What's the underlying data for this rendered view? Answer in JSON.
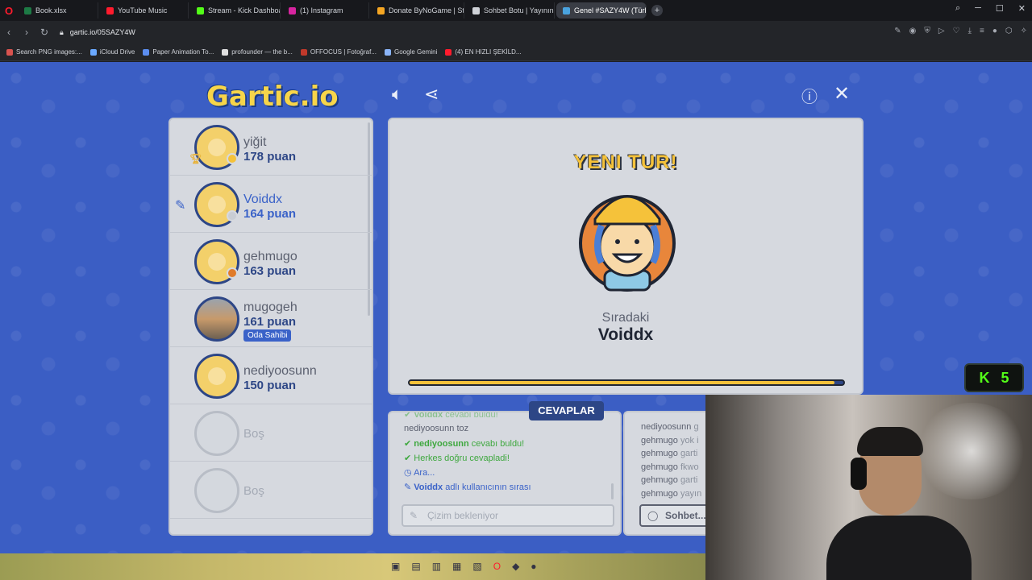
{
  "browser": {
    "tabs": [
      {
        "label": "Book.xlsx",
        "color": "#1d7a45",
        "active": false
      },
      {
        "label": "YouTube Music",
        "color": "#ff1b2d",
        "active": false
      },
      {
        "label": "Stream - Kick Dashboard",
        "color": "#53fc18",
        "active": false
      },
      {
        "label": "(1) Instagram",
        "color": "#d6249f",
        "active": false
      },
      {
        "label": "Donate ByNoGame | Strea",
        "color": "#f5a623",
        "active": false
      },
      {
        "label": "Sohbet Botu | Yayınını güç",
        "color": "#cfd2d8",
        "active": false
      },
      {
        "label": "Genel #SAZY4W (Türk",
        "color": "#4aa3df",
        "active": true
      }
    ],
    "url": "gartic.io/05SAZY4W",
    "bookmarks": [
      {
        "label": "Search PNG images:...",
        "color": "#d9534f"
      },
      {
        "label": "iCloud Drive",
        "color": "#6aa9ff"
      },
      {
        "label": "Paper Animation To...",
        "color": "#5b8def"
      },
      {
        "label": "profounder — the b...",
        "color": "#e0e0e0"
      },
      {
        "label": "OFFOCUS | Fotoğraf...",
        "color": "#c0392b"
      },
      {
        "label": "Google Gemini",
        "color": "#8ab4f8"
      },
      {
        "label": "(4) EN HIZLI ŞEKİLD...",
        "color": "#ff1b2d"
      }
    ]
  },
  "game": {
    "logo": "Gartic.io",
    "players": [
      {
        "name": "yiğit",
        "score": "178 puan",
        "dot_color": "#f5c23a",
        "active": false,
        "owner": "",
        "empty": false
      },
      {
        "name": "Voiddx",
        "score": "164 puan",
        "dot_color": "#c9cdd4",
        "active": true,
        "owner": "",
        "empty": false
      },
      {
        "name": "gehmugo",
        "score": "163 puan",
        "dot_color": "#e07b2a",
        "active": false,
        "owner": "",
        "empty": false
      },
      {
        "name": "mugogeh",
        "score": "161 puan",
        "dot_color": "",
        "active": false,
        "owner": "Oda Sahibi",
        "empty": false
      },
      {
        "name": "nediyoosunn",
        "score": "150 puan",
        "dot_color": "",
        "active": false,
        "owner": "",
        "empty": false
      },
      {
        "name": "Boş",
        "score": "",
        "dot_color": "",
        "active": false,
        "owner": "",
        "empty": true
      },
      {
        "name": "Boş",
        "score": "",
        "dot_color": "",
        "active": false,
        "owner": "",
        "empty": true
      }
    ],
    "stage": {
      "title": "YENI TUR!",
      "next_label": "Sıradaki",
      "next_name": "Voiddx",
      "progress": 0.98
    },
    "answers": {
      "tab_label": "CEVAPLAR",
      "messages": [
        {
          "user": "Voiddx",
          "text": "cevabı buldu!",
          "type": "found-partial"
        },
        {
          "user": "nediyoosunn",
          "text": "toz",
          "type": "plain"
        },
        {
          "user": "nediyoosunn",
          "text": "cevabı buldu!",
          "type": "found"
        },
        {
          "user": "",
          "text": "Herkes doğru cevapladi!",
          "type": "all"
        },
        {
          "user": "",
          "text": "Ara...",
          "type": "break"
        },
        {
          "user": "Voiddx",
          "text": "adlı kullanıcının sırası",
          "type": "turn"
        }
      ],
      "input_placeholder": "Çizim bekleniyor"
    },
    "chat": {
      "messages": [
        {
          "user": "nediyoosunn",
          "text": "g"
        },
        {
          "user": "gehmugo",
          "text": "yok i"
        },
        {
          "user": "gehmugo",
          "text": "garti"
        },
        {
          "user": "gehmugo",
          "text": "fkwo"
        },
        {
          "user": "gehmugo",
          "text": "garti"
        },
        {
          "user": "gehmugo",
          "text": "yayın"
        }
      ],
      "input_placeholder": "Sohbet..."
    }
  },
  "overlay": {
    "kick_label": "K",
    "kick_count": "5"
  }
}
